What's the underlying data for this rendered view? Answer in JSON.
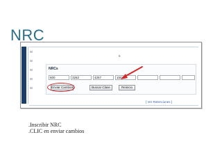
{
  "slide": {
    "title": "NRC",
    "instructions": [
      ".Inscribir NRC",
      ".CLIC en enviar  cambios"
    ]
  },
  "screen": {
    "page_mark": "s",
    "nrc_section": {
      "label": "NRCs",
      "inputs": [
        "600",
        "3262",
        "4257",
        "1504",
        "",
        "",
        "",
        "",
        "",
        ""
      ]
    },
    "buttons": {
      "submit_label": "Enviar Cambios",
      "search_label": "Buscar Clase",
      "reset_label": "Reinicio"
    },
    "retention_link": "[ Ver Retenciones ]",
    "annotation_color": "#d22a2a"
  }
}
